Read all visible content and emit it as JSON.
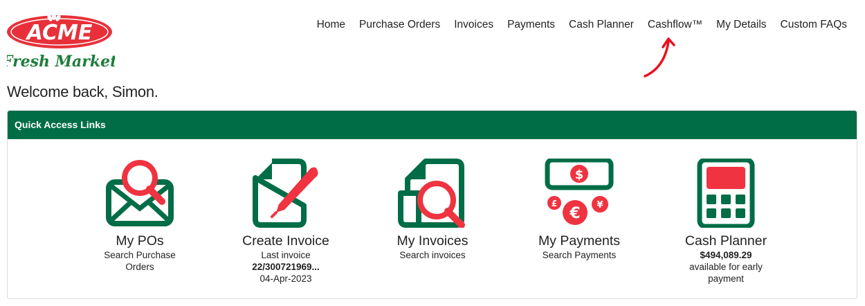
{
  "logo": {
    "brand": "ACME",
    "tagline": "Fresh Market"
  },
  "nav": {
    "items": [
      {
        "label": "Home"
      },
      {
        "label": "Purchase Orders"
      },
      {
        "label": "Invoices"
      },
      {
        "label": "Payments"
      },
      {
        "label": "Cash Planner"
      },
      {
        "label": "Cashflow™"
      },
      {
        "label": "My Details"
      },
      {
        "label": "Custom FAQs"
      }
    ]
  },
  "welcome": "Welcome back, Simon.",
  "panel": {
    "title": "Quick Access Links",
    "tiles": [
      {
        "title": "My POs",
        "line1": "Search Purchase",
        "line2": "Orders"
      },
      {
        "title": "Create Invoice",
        "line1": "Last invoice",
        "line2": "22/300721969...",
        "line3": "04-Apr-2023"
      },
      {
        "title": "My Invoices",
        "line1": "Search invoices"
      },
      {
        "title": "My Payments",
        "line1": "Search Payments"
      },
      {
        "title": "Cash Planner",
        "line1": "$494,089.29",
        "line2": "available for early",
        "line3": "payment"
      }
    ]
  },
  "colors": {
    "green": "#006d47",
    "red": "#ef3340",
    "header_bg": "#006d47"
  }
}
